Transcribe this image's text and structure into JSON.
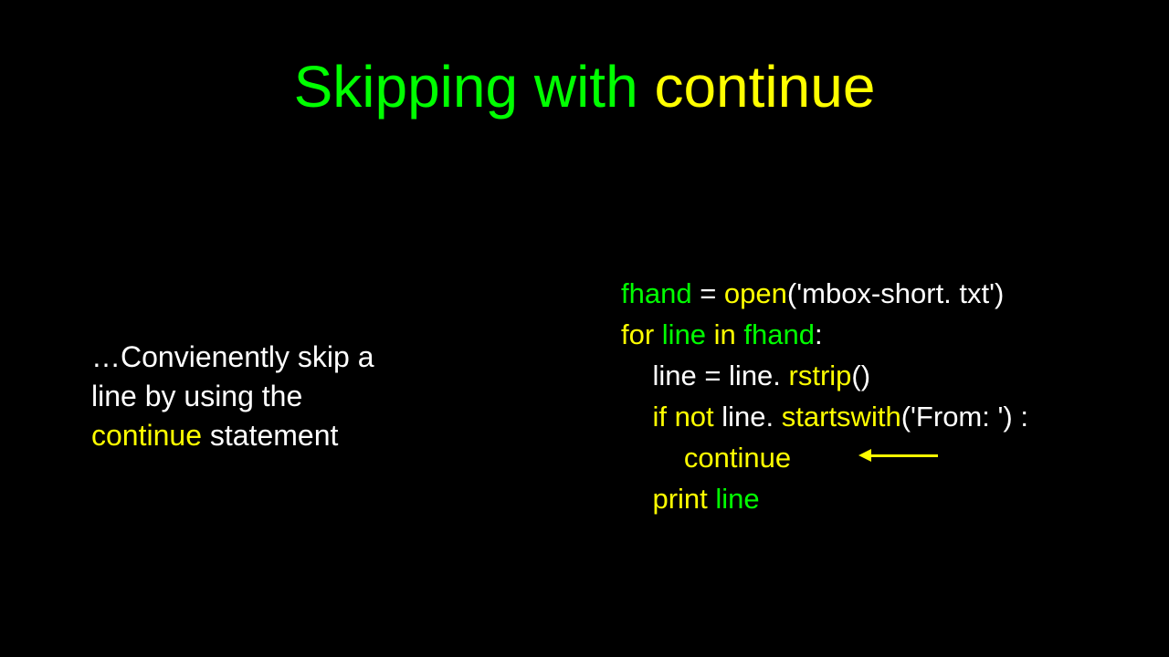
{
  "title": {
    "part1": "Skipping with",
    "part2": "continue"
  },
  "body": {
    "line1": "…Convienently skip a",
    "line2": "line by using the",
    "line3_yellow": "continue",
    "line3_rest": " statement"
  },
  "code": {
    "l1_name": "fhand",
    "l1_eq": " = ",
    "l1_fn": "open",
    "l1_arg": "('mbox-short. txt')",
    "l2_kw": "for ",
    "l2_var": "line ",
    "l2_in": "in ",
    "l2_iter": "fhand",
    "l2_colon": ":",
    "l3_indent": "    ",
    "l3_lhs": "line = line. ",
    "l3_fn": "rstrip",
    "l3_paren": "()",
    "l4_indent": "    ",
    "l4_if": "if not ",
    "l4_obj": "line. ",
    "l4_fn": "startswith",
    "l4_arg": "('From: ') :",
    "l5_indent": "        ",
    "l5_kw": "continue",
    "l6_indent": "    ",
    "l6_print": "print ",
    "l6_var": "line"
  }
}
